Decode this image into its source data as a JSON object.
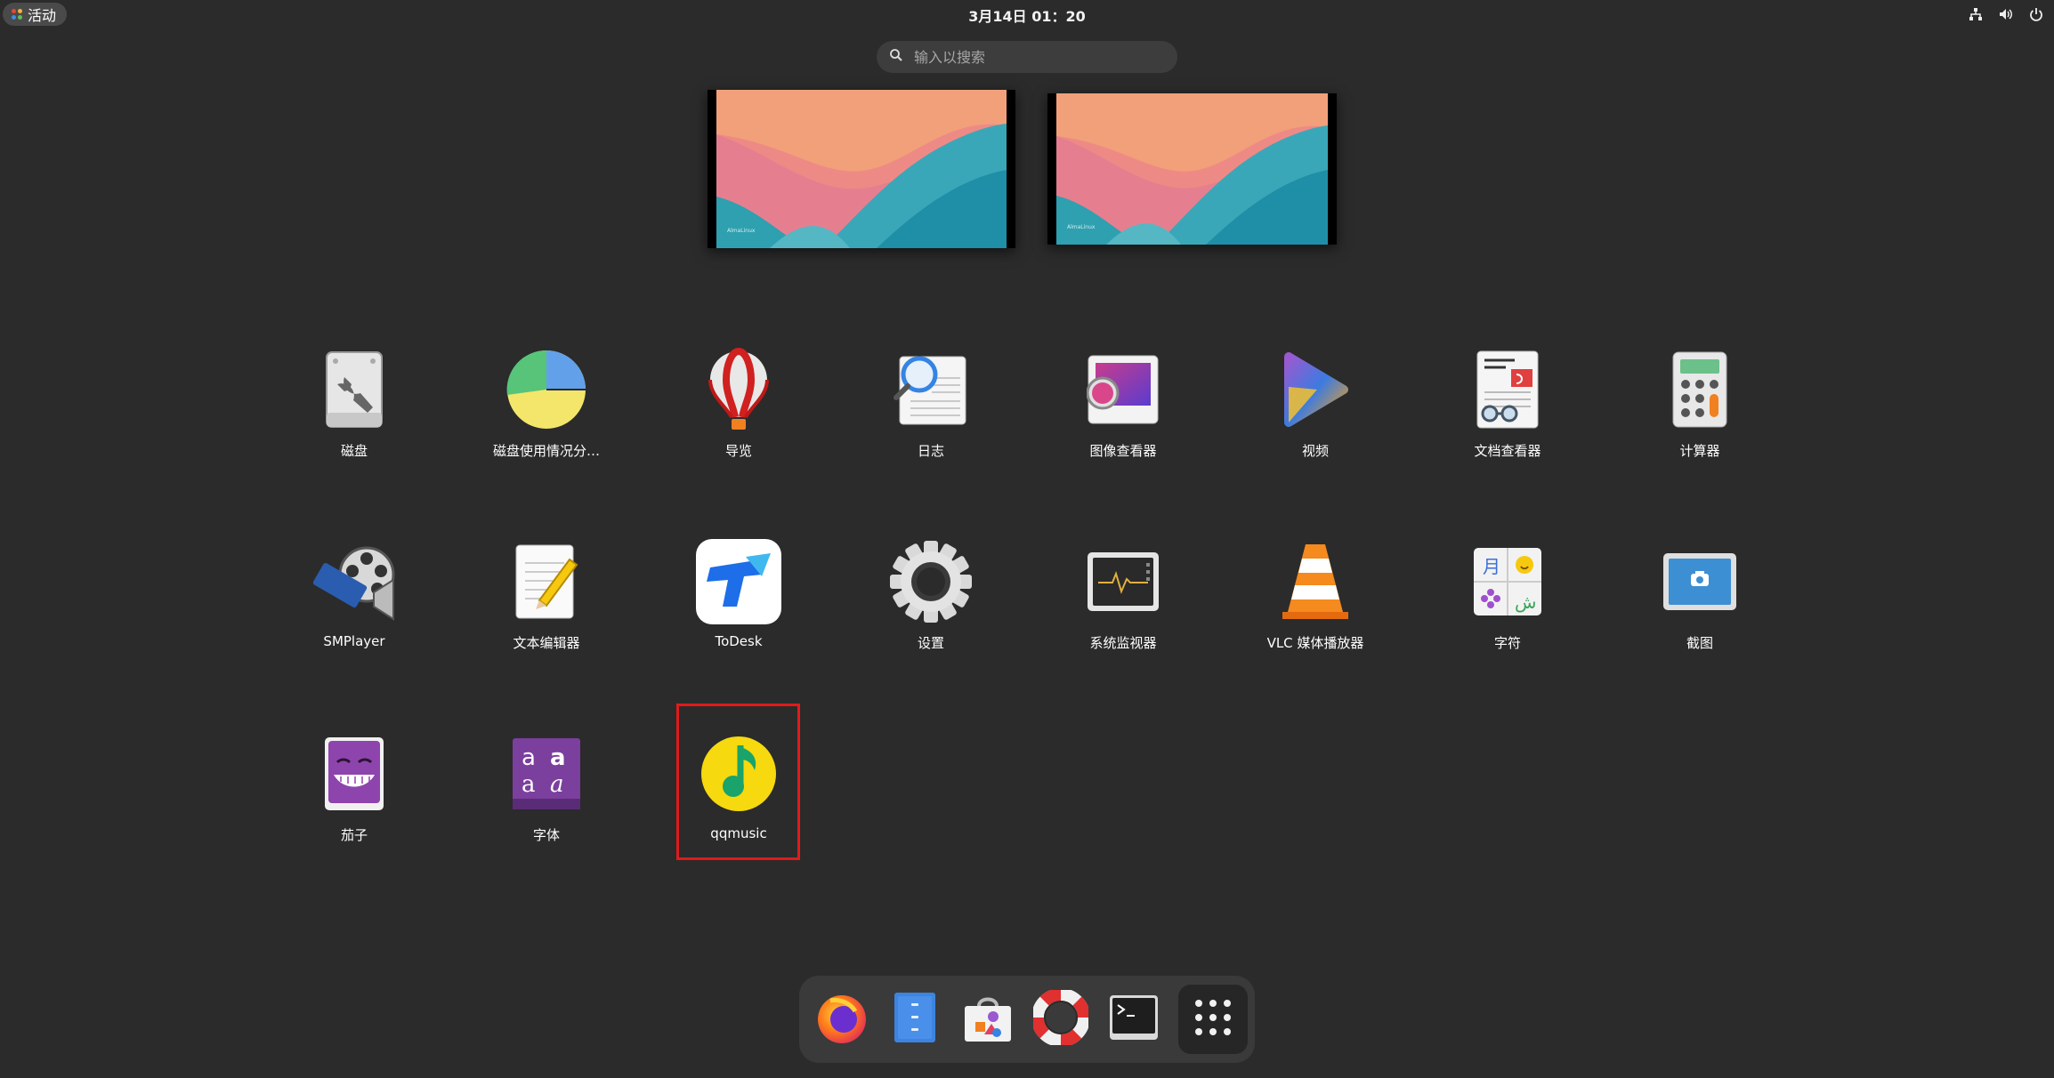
{
  "topbar": {
    "activities_label": "活动",
    "clock": "3月14日  01：20",
    "tray_icons": [
      "network-icon",
      "volume-icon",
      "power-icon"
    ]
  },
  "search": {
    "placeholder": "输入以搜索"
  },
  "workspaces": {
    "brand_text": "AlmaLinux"
  },
  "apps": [
    {
      "label": "磁盘",
      "icon": "disks-icon"
    },
    {
      "label": "磁盘使用情况分…",
      "icon": "disk-usage-icon"
    },
    {
      "label": "导览",
      "icon": "tour-balloon-icon"
    },
    {
      "label": "日志",
      "icon": "logs-icon"
    },
    {
      "label": "图像查看器",
      "icon": "image-viewer-icon"
    },
    {
      "label": "视频",
      "icon": "videos-icon"
    },
    {
      "label": "文档查看器",
      "icon": "document-viewer-icon"
    },
    {
      "label": "计算器",
      "icon": "calculator-icon"
    },
    {
      "label": "SMPlayer",
      "icon": "smplayer-icon"
    },
    {
      "label": "文本编辑器",
      "icon": "text-editor-icon"
    },
    {
      "label": "ToDesk",
      "icon": "todesk-icon"
    },
    {
      "label": "设置",
      "icon": "settings-gear-icon"
    },
    {
      "label": "系统监视器",
      "icon": "system-monitor-icon"
    },
    {
      "label": "VLC 媒体播放器",
      "icon": "vlc-cone-icon"
    },
    {
      "label": "字符",
      "icon": "characters-icon"
    },
    {
      "label": "截图",
      "icon": "screenshot-icon"
    },
    {
      "label": "茄子",
      "icon": "cheese-icon"
    },
    {
      "label": "字体",
      "icon": "fonts-icon"
    },
    {
      "label": "qqmusic",
      "icon": "qqmusic-icon"
    }
  ],
  "dock": [
    {
      "icon": "firefox-icon"
    },
    {
      "icon": "files-icon"
    },
    {
      "icon": "software-store-icon"
    },
    {
      "icon": "help-lifebuoy-icon"
    },
    {
      "icon": "terminal-icon"
    },
    {
      "icon": "show-apps-grid-icon"
    }
  ],
  "colors": {
    "background": "#2b2b2b",
    "highlight": "#e11b1b",
    "dock": "#3a3a3a"
  }
}
